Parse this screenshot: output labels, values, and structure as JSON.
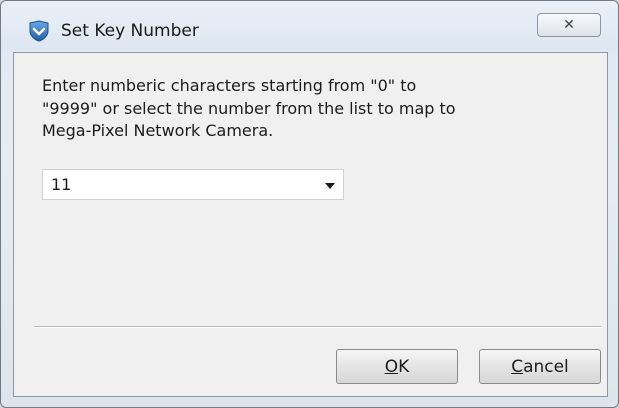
{
  "window": {
    "title": "Set Key Number",
    "close_glyph": "✕",
    "icon": "app-shield-icon"
  },
  "dialog": {
    "instructions_lines": [
      "Enter numberic characters starting from \"0\" to",
      "\"9999\" or select the number from the list to map to",
      "Mega-Pixel Network Camera."
    ],
    "key_number": {
      "selected_value": "11"
    }
  },
  "buttons": {
    "ok": {
      "mnemonic": "O",
      "rest": "K"
    },
    "cancel": {
      "mnemonic": "C",
      "rest": "ancel"
    }
  },
  "colors": {
    "accent": "#2d6fb8",
    "client_background": "#f0f0f0"
  }
}
